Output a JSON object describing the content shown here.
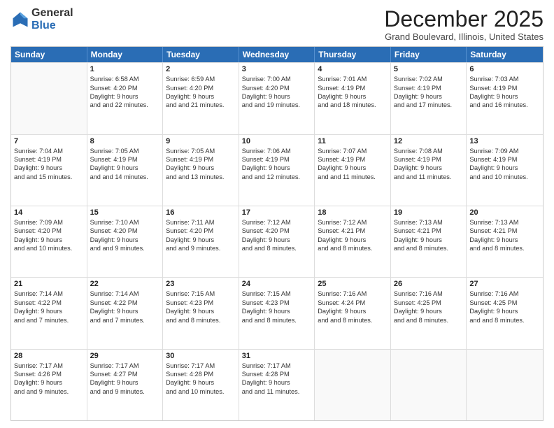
{
  "logo": {
    "general": "General",
    "blue": "Blue"
  },
  "title": "December 2025",
  "location": "Grand Boulevard, Illinois, United States",
  "header_days": [
    "Sunday",
    "Monday",
    "Tuesday",
    "Wednesday",
    "Thursday",
    "Friday",
    "Saturday"
  ],
  "weeks": [
    [
      {
        "day": "",
        "sunrise": "",
        "sunset": "",
        "daylight": ""
      },
      {
        "day": "1",
        "sunrise": "Sunrise: 6:58 AM",
        "sunset": "Sunset: 4:20 PM",
        "daylight": "Daylight: 9 hours and 22 minutes."
      },
      {
        "day": "2",
        "sunrise": "Sunrise: 6:59 AM",
        "sunset": "Sunset: 4:20 PM",
        "daylight": "Daylight: 9 hours and 21 minutes."
      },
      {
        "day": "3",
        "sunrise": "Sunrise: 7:00 AM",
        "sunset": "Sunset: 4:20 PM",
        "daylight": "Daylight: 9 hours and 19 minutes."
      },
      {
        "day": "4",
        "sunrise": "Sunrise: 7:01 AM",
        "sunset": "Sunset: 4:19 PM",
        "daylight": "Daylight: 9 hours and 18 minutes."
      },
      {
        "day": "5",
        "sunrise": "Sunrise: 7:02 AM",
        "sunset": "Sunset: 4:19 PM",
        "daylight": "Daylight: 9 hours and 17 minutes."
      },
      {
        "day": "6",
        "sunrise": "Sunrise: 7:03 AM",
        "sunset": "Sunset: 4:19 PM",
        "daylight": "Daylight: 9 hours and 16 minutes."
      }
    ],
    [
      {
        "day": "7",
        "sunrise": "Sunrise: 7:04 AM",
        "sunset": "Sunset: 4:19 PM",
        "daylight": "Daylight: 9 hours and 15 minutes."
      },
      {
        "day": "8",
        "sunrise": "Sunrise: 7:05 AM",
        "sunset": "Sunset: 4:19 PM",
        "daylight": "Daylight: 9 hours and 14 minutes."
      },
      {
        "day": "9",
        "sunrise": "Sunrise: 7:05 AM",
        "sunset": "Sunset: 4:19 PM",
        "daylight": "Daylight: 9 hours and 13 minutes."
      },
      {
        "day": "10",
        "sunrise": "Sunrise: 7:06 AM",
        "sunset": "Sunset: 4:19 PM",
        "daylight": "Daylight: 9 hours and 12 minutes."
      },
      {
        "day": "11",
        "sunrise": "Sunrise: 7:07 AM",
        "sunset": "Sunset: 4:19 PM",
        "daylight": "Daylight: 9 hours and 11 minutes."
      },
      {
        "day": "12",
        "sunrise": "Sunrise: 7:08 AM",
        "sunset": "Sunset: 4:19 PM",
        "daylight": "Daylight: 9 hours and 11 minutes."
      },
      {
        "day": "13",
        "sunrise": "Sunrise: 7:09 AM",
        "sunset": "Sunset: 4:19 PM",
        "daylight": "Daylight: 9 hours and 10 minutes."
      }
    ],
    [
      {
        "day": "14",
        "sunrise": "Sunrise: 7:09 AM",
        "sunset": "Sunset: 4:20 PM",
        "daylight": "Daylight: 9 hours and 10 minutes."
      },
      {
        "day": "15",
        "sunrise": "Sunrise: 7:10 AM",
        "sunset": "Sunset: 4:20 PM",
        "daylight": "Daylight: 9 hours and 9 minutes."
      },
      {
        "day": "16",
        "sunrise": "Sunrise: 7:11 AM",
        "sunset": "Sunset: 4:20 PM",
        "daylight": "Daylight: 9 hours and 9 minutes."
      },
      {
        "day": "17",
        "sunrise": "Sunrise: 7:12 AM",
        "sunset": "Sunset: 4:20 PM",
        "daylight": "Daylight: 9 hours and 8 minutes."
      },
      {
        "day": "18",
        "sunrise": "Sunrise: 7:12 AM",
        "sunset": "Sunset: 4:21 PM",
        "daylight": "Daylight: 9 hours and 8 minutes."
      },
      {
        "day": "19",
        "sunrise": "Sunrise: 7:13 AM",
        "sunset": "Sunset: 4:21 PM",
        "daylight": "Daylight: 9 hours and 8 minutes."
      },
      {
        "day": "20",
        "sunrise": "Sunrise: 7:13 AM",
        "sunset": "Sunset: 4:21 PM",
        "daylight": "Daylight: 9 hours and 8 minutes."
      }
    ],
    [
      {
        "day": "21",
        "sunrise": "Sunrise: 7:14 AM",
        "sunset": "Sunset: 4:22 PM",
        "daylight": "Daylight: 9 hours and 7 minutes."
      },
      {
        "day": "22",
        "sunrise": "Sunrise: 7:14 AM",
        "sunset": "Sunset: 4:22 PM",
        "daylight": "Daylight: 9 hours and 7 minutes."
      },
      {
        "day": "23",
        "sunrise": "Sunrise: 7:15 AM",
        "sunset": "Sunset: 4:23 PM",
        "daylight": "Daylight: 9 hours and 8 minutes."
      },
      {
        "day": "24",
        "sunrise": "Sunrise: 7:15 AM",
        "sunset": "Sunset: 4:23 PM",
        "daylight": "Daylight: 9 hours and 8 minutes."
      },
      {
        "day": "25",
        "sunrise": "Sunrise: 7:16 AM",
        "sunset": "Sunset: 4:24 PM",
        "daylight": "Daylight: 9 hours and 8 minutes."
      },
      {
        "day": "26",
        "sunrise": "Sunrise: 7:16 AM",
        "sunset": "Sunset: 4:25 PM",
        "daylight": "Daylight: 9 hours and 8 minutes."
      },
      {
        "day": "27",
        "sunrise": "Sunrise: 7:16 AM",
        "sunset": "Sunset: 4:25 PM",
        "daylight": "Daylight: 9 hours and 8 minutes."
      }
    ],
    [
      {
        "day": "28",
        "sunrise": "Sunrise: 7:17 AM",
        "sunset": "Sunset: 4:26 PM",
        "daylight": "Daylight: 9 hours and 9 minutes."
      },
      {
        "day": "29",
        "sunrise": "Sunrise: 7:17 AM",
        "sunset": "Sunset: 4:27 PM",
        "daylight": "Daylight: 9 hours and 9 minutes."
      },
      {
        "day": "30",
        "sunrise": "Sunrise: 7:17 AM",
        "sunset": "Sunset: 4:28 PM",
        "daylight": "Daylight: 9 hours and 10 minutes."
      },
      {
        "day": "31",
        "sunrise": "Sunrise: 7:17 AM",
        "sunset": "Sunset: 4:28 PM",
        "daylight": "Daylight: 9 hours and 11 minutes."
      },
      {
        "day": "",
        "sunrise": "",
        "sunset": "",
        "daylight": ""
      },
      {
        "day": "",
        "sunrise": "",
        "sunset": "",
        "daylight": ""
      },
      {
        "day": "",
        "sunrise": "",
        "sunset": "",
        "daylight": ""
      }
    ]
  ]
}
